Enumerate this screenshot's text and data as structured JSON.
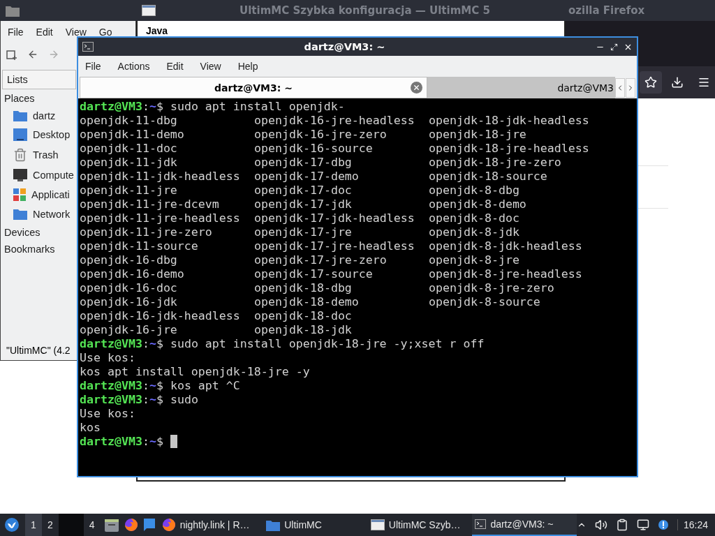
{
  "file_manager": {
    "menu": [
      "File",
      "Edit",
      "View",
      "Go"
    ],
    "tab": "Lists",
    "sections": [
      {
        "label": "Places",
        "items": [
          {
            "label": "dartz",
            "kind": "home"
          },
          {
            "label": "Desktop",
            "kind": "desktop"
          },
          {
            "label": "Trash",
            "kind": "trash"
          },
          {
            "label": "Compute",
            "kind": "computer"
          },
          {
            "label": "Applicati",
            "kind": "apps"
          },
          {
            "label": "Network",
            "kind": "network"
          }
        ]
      },
      {
        "label": "Devices"
      },
      {
        "label": "Bookmarks"
      }
    ],
    "status_bar": "\"UltimMC\" (4.2"
  },
  "setup_window": {
    "title": "UltimMC Szybka konfiguracja — UltimMC 5",
    "heading": "Java"
  },
  "browser": {
    "title": "ozilla Firefox"
  },
  "terminal": {
    "title": "dartz@VM3: ~",
    "menu": [
      "File",
      "Actions",
      "Edit",
      "View",
      "Help"
    ],
    "tabs": [
      {
        "label": "dartz@VM3: ~",
        "selected": true
      },
      {
        "label": "dartz@VM3",
        "selected": false
      }
    ],
    "lines": [
      {
        "kind": "prompt",
        "user": "dartz@VM3",
        "sep": ":",
        "path": "~",
        "sign": "$",
        "command": "sudo apt install openjdk-",
        "cursor": false
      },
      {
        "kind": "columns",
        "cells": [
          "openjdk-11-dbg",
          "openjdk-16-jre-headless",
          "openjdk-18-jdk-headless"
        ]
      },
      {
        "kind": "columns",
        "cells": [
          "openjdk-11-demo",
          "openjdk-16-jre-zero",
          "openjdk-18-jre"
        ]
      },
      {
        "kind": "columns",
        "cells": [
          "openjdk-11-doc",
          "openjdk-16-source",
          "openjdk-18-jre-headless"
        ]
      },
      {
        "kind": "columns",
        "cells": [
          "openjdk-11-jdk",
          "openjdk-17-dbg",
          "openjdk-18-jre-zero"
        ]
      },
      {
        "kind": "columns",
        "cells": [
          "openjdk-11-jdk-headless",
          "openjdk-17-demo",
          "openjdk-18-source"
        ]
      },
      {
        "kind": "columns",
        "cells": [
          "openjdk-11-jre",
          "openjdk-17-doc",
          "openjdk-8-dbg"
        ]
      },
      {
        "kind": "columns",
        "cells": [
          "openjdk-11-jre-dcevm",
          "openjdk-17-jdk",
          "openjdk-8-demo"
        ]
      },
      {
        "kind": "columns",
        "cells": [
          "openjdk-11-jre-headless",
          "openjdk-17-jdk-headless",
          "openjdk-8-doc"
        ]
      },
      {
        "kind": "columns",
        "cells": [
          "openjdk-11-jre-zero",
          "openjdk-17-jre",
          "openjdk-8-jdk"
        ]
      },
      {
        "kind": "columns",
        "cells": [
          "openjdk-11-source",
          "openjdk-17-jre-headless",
          "openjdk-8-jdk-headless"
        ]
      },
      {
        "kind": "columns",
        "cells": [
          "openjdk-16-dbg",
          "openjdk-17-jre-zero",
          "openjdk-8-jre"
        ]
      },
      {
        "kind": "columns",
        "cells": [
          "openjdk-16-demo",
          "openjdk-17-source",
          "openjdk-8-jre-headless"
        ]
      },
      {
        "kind": "columns",
        "cells": [
          "openjdk-16-doc",
          "openjdk-18-dbg",
          "openjdk-8-jre-zero"
        ]
      },
      {
        "kind": "columns",
        "cells": [
          "openjdk-16-jdk",
          "openjdk-18-demo",
          "openjdk-8-source"
        ]
      },
      {
        "kind": "columns",
        "cells": [
          "openjdk-16-jdk-headless",
          "openjdk-18-doc"
        ]
      },
      {
        "kind": "columns",
        "cells": [
          "openjdk-16-jre",
          "openjdk-18-jdk"
        ]
      },
      {
        "kind": "prompt",
        "user": "dartz@VM3",
        "sep": ":",
        "path": "~",
        "sign": "$",
        "command": "sudo apt install openjdk-18-jre -y;xset r off",
        "cursor": false
      },
      {
        "kind": "output",
        "text": "Use kos:"
      },
      {
        "kind": "output",
        "text": "kos apt install openjdk-18-jre -y"
      },
      {
        "kind": "prompt",
        "user": "dartz@VM3",
        "sep": ":",
        "path": "~",
        "sign": "$",
        "command": "kos apt ^C",
        "cursor": false
      },
      {
        "kind": "prompt",
        "user": "dartz@VM3",
        "sep": ":",
        "path": "~",
        "sign": "$",
        "command": "sudo",
        "cursor": false
      },
      {
        "kind": "output",
        "text": "Use kos:"
      },
      {
        "kind": "output",
        "text": "kos"
      },
      {
        "kind": "prompt",
        "user": "dartz@VM3",
        "sep": ":",
        "path": "~",
        "sign": "$",
        "cursor": true
      }
    ]
  },
  "taskbar": {
    "workspaces": [
      {
        "label": "1",
        "selected": true
      },
      {
        "label": "2",
        "selected": false
      },
      {
        "label": "4",
        "selected": false
      }
    ],
    "tasks": [
      {
        "label": "nightly.link | R…",
        "kind": "browser",
        "selected": false
      },
      {
        "label": "UltimMC",
        "kind": "folder",
        "selected": false
      },
      {
        "label": "UltimMC Szyb…",
        "kind": "window",
        "selected": false
      },
      {
        "label": "dartz@VM3: ~",
        "kind": "terminal",
        "selected": true
      }
    ],
    "clock": "16:24"
  }
}
